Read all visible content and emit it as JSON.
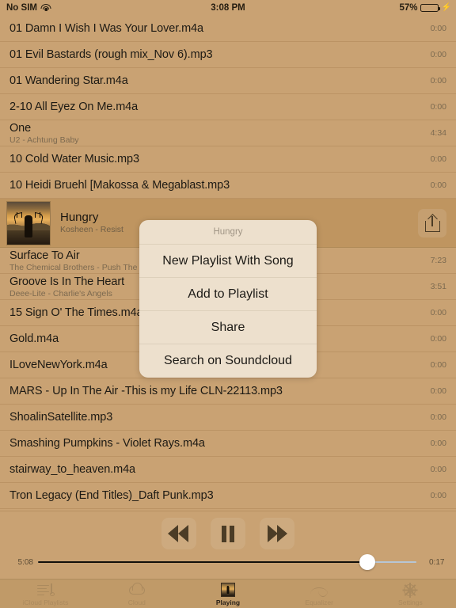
{
  "status_bar": {
    "carrier": "No SIM",
    "wifi_icon": "wifi-icon",
    "time": "3:08 PM",
    "battery_percent": "57%",
    "battery_level": 57,
    "battery_color": "#4cd964",
    "charging_icon": "lightning-bolt-icon"
  },
  "songs": [
    {
      "title": "01 Damn I Wish I Was Your Lover.m4a",
      "subtitle": "",
      "duration": "0:00"
    },
    {
      "title": "01 Evil Bastards (rough mix_Nov 6).mp3",
      "subtitle": "",
      "duration": "0:00"
    },
    {
      "title": "01 Wandering Star.m4a",
      "subtitle": "",
      "duration": "0:00"
    },
    {
      "title": "2-10 All Eyez On Me.m4a",
      "subtitle": "",
      "duration": "0:00"
    },
    {
      "title": "One",
      "subtitle": "U2 - Achtung Baby",
      "duration": "4:34"
    },
    {
      "title": "10 Cold Water Music.mp3",
      "subtitle": "",
      "duration": "0:00"
    },
    {
      "title": "10 Heidi Bruehl [Makossa & Megablast.mp3",
      "subtitle": "",
      "duration": "0:00"
    }
  ],
  "now_playing": {
    "title": "Hungry",
    "subtitle": "Kosheen - Resist",
    "artwork_icon": "album-art-deer-sunset",
    "share_icon": "share-icon"
  },
  "songs_after": [
    {
      "title": "Surface To Air",
      "subtitle": "The Chemical Brothers - Push The Butt",
      "duration": "7:23"
    },
    {
      "title": "Groove Is In The Heart",
      "subtitle": "Deee-Lite - Charlie's Angels",
      "duration": "3:51"
    },
    {
      "title": "15 Sign O' The Times.m4a",
      "subtitle": "",
      "duration": "0:00"
    },
    {
      "title": "Gold.m4a",
      "subtitle": "",
      "duration": "0:00"
    },
    {
      "title": "ILoveNewYork.m4a",
      "subtitle": "",
      "duration": "0:00"
    },
    {
      "title": "MARS - Up In The Air -This is my Life CLN-22113.mp3",
      "subtitle": "",
      "duration": "0:00"
    },
    {
      "title": "ShoalinSatellite.mp3",
      "subtitle": "",
      "duration": "0:00"
    },
    {
      "title": "Smashing Pumpkins - Violet Rays.m4a",
      "subtitle": "",
      "duration": "0:00"
    },
    {
      "title": "stairway_to_heaven.m4a",
      "subtitle": "",
      "duration": "0:00"
    },
    {
      "title": "Tron Legacy (End Titles)_Daft Punk.mp3",
      "subtitle": "",
      "duration": "0:00"
    }
  ],
  "action_sheet": {
    "title": "Hungry",
    "items": [
      "New Playlist With Song",
      "Add to Playlist",
      "Share",
      "Search on Soundcloud"
    ]
  },
  "player": {
    "rewind_icon": "rewind-icon",
    "pause_icon": "pause-icon",
    "forward_icon": "fast-forward-icon",
    "elapsed": "5:08",
    "remaining": "0:17",
    "progress_percent": 87
  },
  "tabs": [
    {
      "label": "iCloud Playlists",
      "icon": "playlist-note-icon",
      "active": false
    },
    {
      "label": "Cloud",
      "icon": "cloud-icon",
      "active": false
    },
    {
      "label": "Playing",
      "icon": "now-playing-art-icon",
      "active": true
    },
    {
      "label": "Equalizer",
      "icon": "waveform-icon",
      "active": false
    },
    {
      "label": "Settings",
      "icon": "gear-icon",
      "active": false
    }
  ],
  "colors": {
    "background": "#c9a273",
    "now_playing_row": "#bf9560",
    "tab_bar": "#c09a68",
    "sheet": "#ede0cd",
    "accent_text": "#1d1a14"
  }
}
